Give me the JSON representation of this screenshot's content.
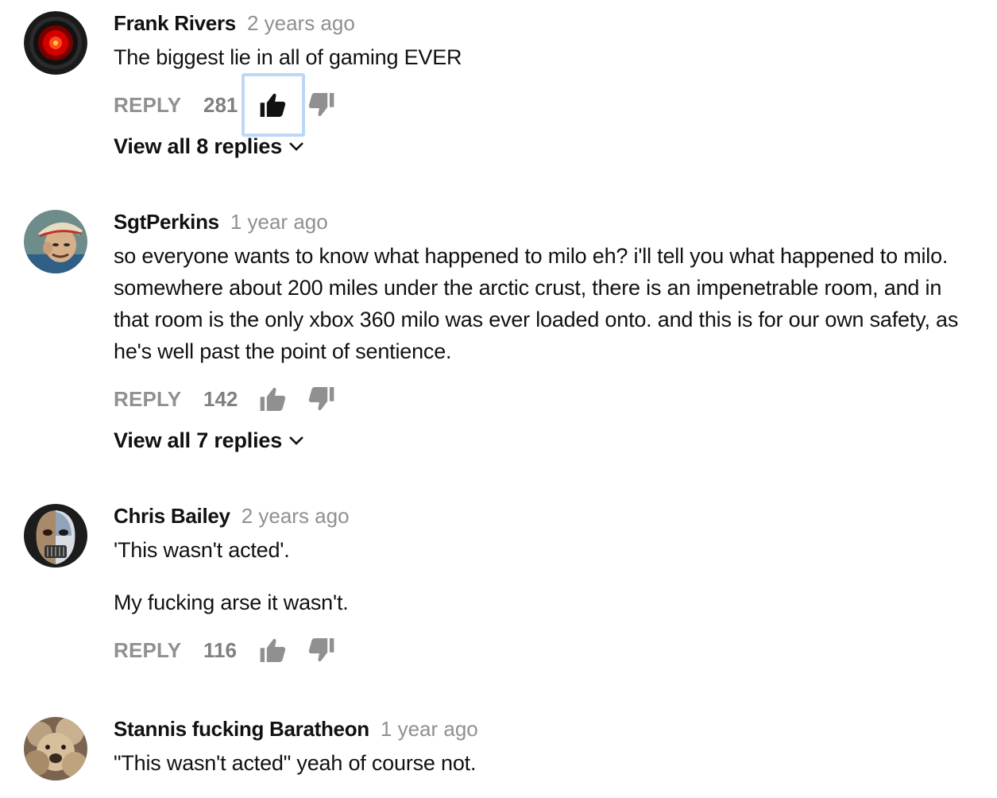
{
  "comments": [
    {
      "author": "Frank Rivers",
      "time": "2 years ago",
      "paragraphs": [
        "The biggest lie in all of gaming EVER"
      ],
      "reply_label": "REPLY",
      "likes": "281",
      "like_active": true,
      "view_replies": "View all 8 replies",
      "avatar": "hal-9000-red-eye"
    },
    {
      "author": "SgtPerkins",
      "time": "1 year ago",
      "paragraphs": [
        "so everyone wants to know what happened to milo eh? i'll tell you what happened to milo. somewhere about 200 miles under the arctic crust, there is an impenetrable room, and in that room is the only xbox 360 milo was ever loaded onto. and this is for our own safety, as he's well past the point of sentience."
      ],
      "reply_label": "REPLY",
      "likes": "142",
      "like_active": false,
      "view_replies": "View all 7 replies",
      "avatar": "cartoon-character"
    },
    {
      "author": "Chris Bailey",
      "time": "2 years ago",
      "paragraphs": [
        "'This wasn't acted'.",
        "My fucking arse it wasn't."
      ],
      "reply_label": "REPLY",
      "likes": "116",
      "like_active": false,
      "avatar": "masked-face"
    },
    {
      "author": "Stannis fucking Baratheon",
      "time": "1 year ago",
      "paragraphs": [
        "\"This wasn't acted\" yeah of course not."
      ],
      "avatar": "fluffy-dog"
    }
  ],
  "colors": {
    "text": "#111111",
    "muted": "#909090",
    "focus_ring": "#bcd8f5"
  }
}
